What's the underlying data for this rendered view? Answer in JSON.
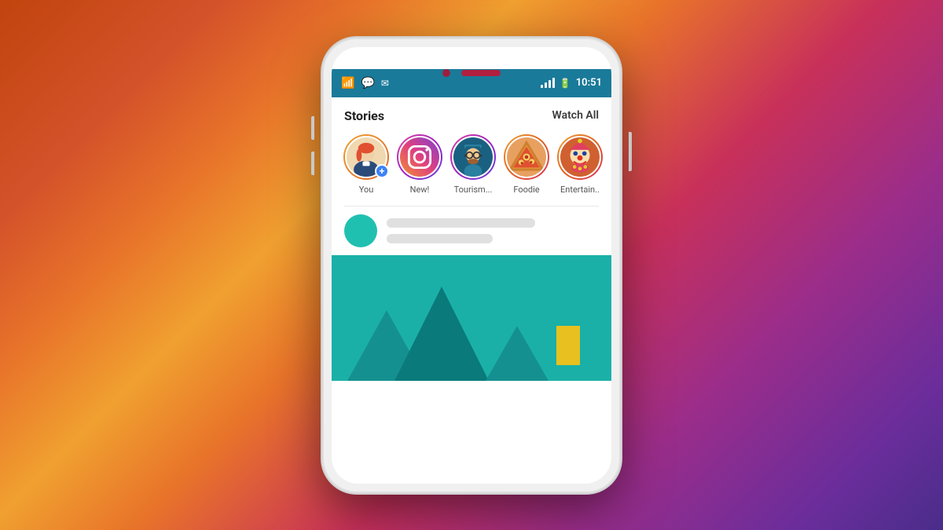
{
  "background": {
    "gradient_start": "#c1440e",
    "gradient_end": "#4a2d8a"
  },
  "status_bar": {
    "time": "10:51",
    "bg_color": "#1a7a9a"
  },
  "stories_section": {
    "title": "Stories",
    "watch_all_label": "Watch All",
    "items": [
      {
        "id": "you",
        "label": "You",
        "has_add": true
      },
      {
        "id": "new",
        "label": "New!",
        "has_add": false
      },
      {
        "id": "tourism",
        "label": "Tourism...",
        "has_add": false
      },
      {
        "id": "foodie",
        "label": "Foodie",
        "has_add": false
      },
      {
        "id": "entertain",
        "label": "Entertain..",
        "has_add": false
      }
    ]
  },
  "add_badge_label": "+",
  "phone": {
    "camera_color": "#9b2040",
    "speaker_color": "#b02040"
  }
}
